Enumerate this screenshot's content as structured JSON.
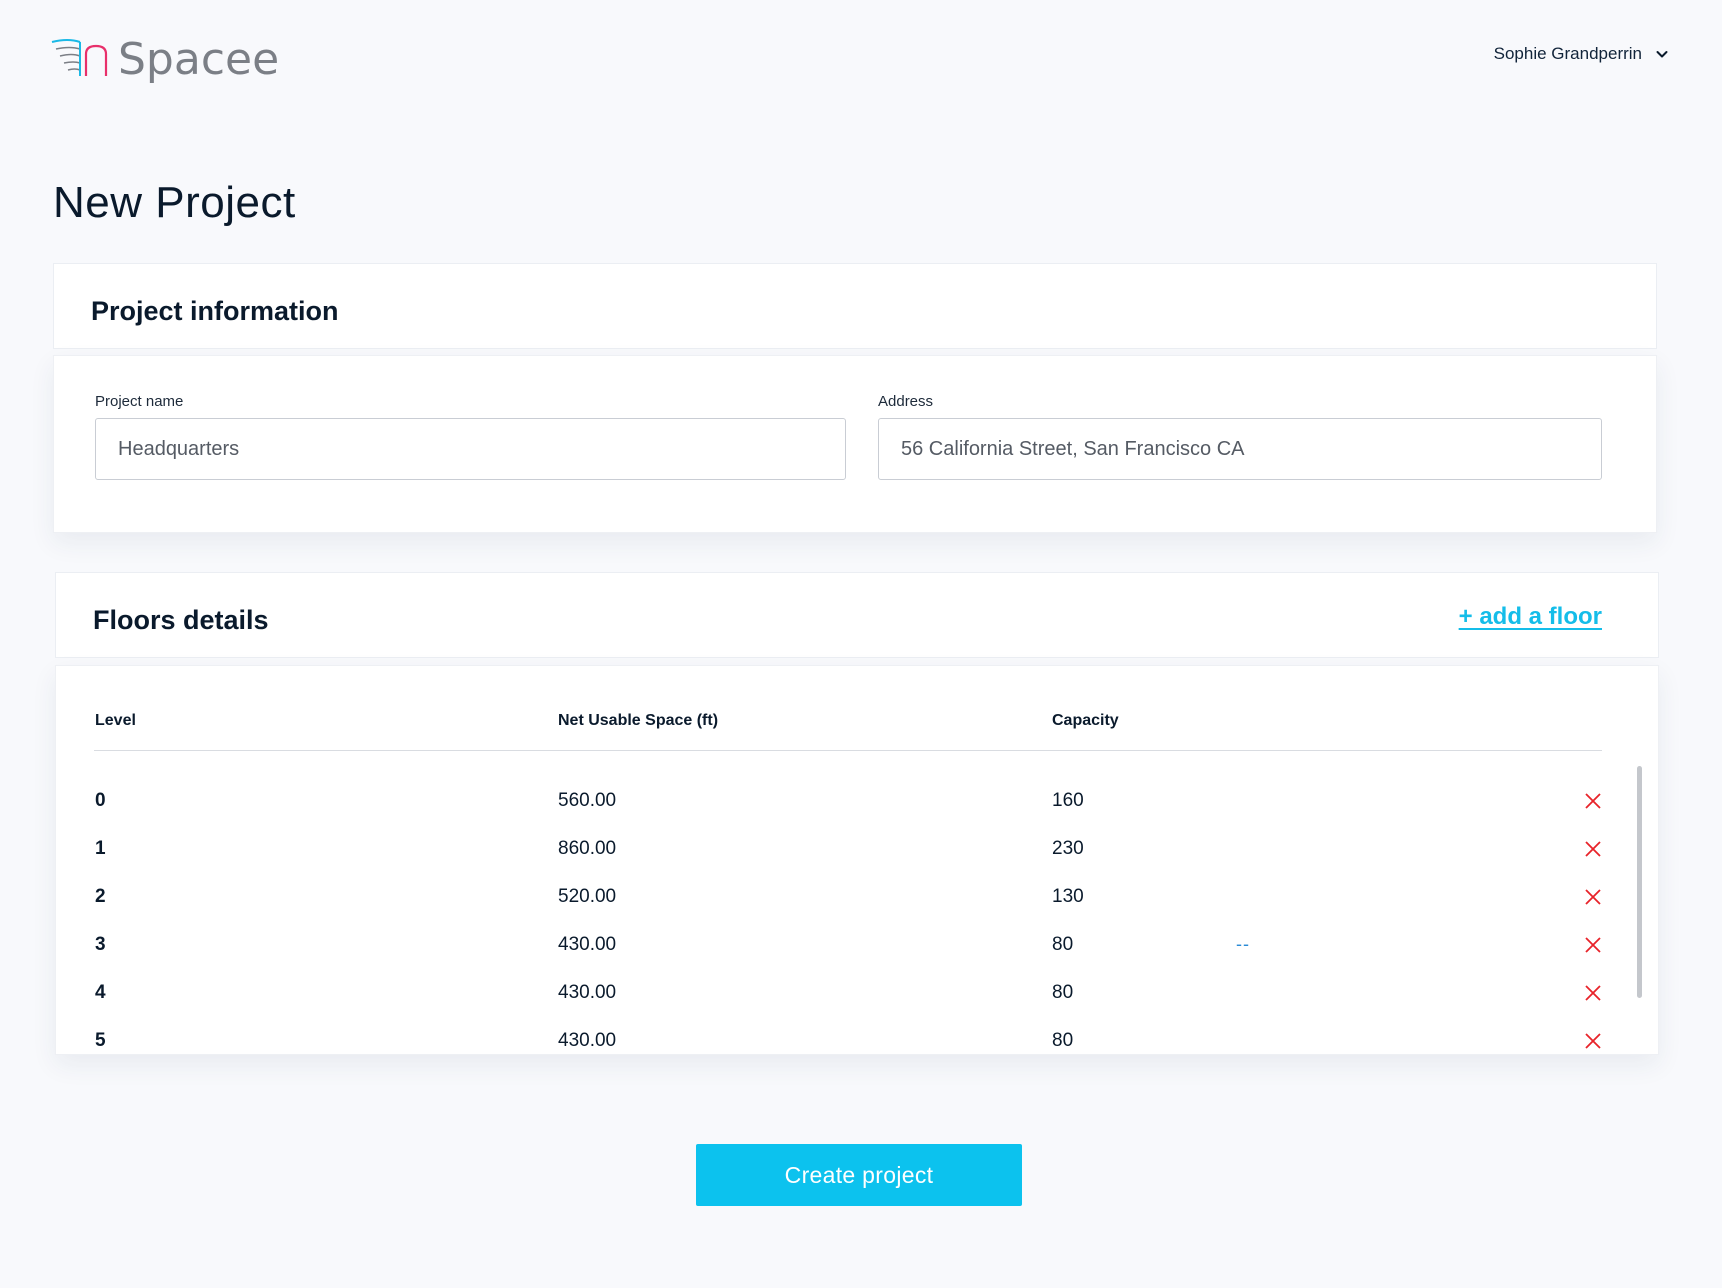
{
  "brand": {
    "name": "Spacee",
    "logo_icon": "wind-lines-logo-icon"
  },
  "user_menu": {
    "name": "Sophie Grandperrin",
    "icon": "chevron-down-icon"
  },
  "page": {
    "title": "New Project"
  },
  "project_info": {
    "heading": "Project information",
    "name_label": "Project name",
    "name_value": "Headquarters",
    "address_label": "Address",
    "address_value": "56 California Street, San Francisco CA"
  },
  "floors": {
    "heading": "Floors details",
    "add_link": "+ add a floor",
    "columns": [
      "Level",
      "Net Usable Space (ft)",
      "Capacity"
    ],
    "rows": [
      {
        "level": "0",
        "space": "560.00",
        "capacity": "160"
      },
      {
        "level": "1",
        "space": "860.00",
        "capacity": "230"
      },
      {
        "level": "2",
        "space": "520.00",
        "capacity": "130"
      },
      {
        "level": "3",
        "space": "430.00",
        "capacity": "80"
      },
      {
        "level": "4",
        "space": "430.00",
        "capacity": "80"
      },
      {
        "level": "5",
        "space": "430.00",
        "capacity": "80"
      }
    ],
    "stray_mark": "--",
    "delete_icon": "close-x-icon"
  },
  "actions": {
    "create_label": "Create project"
  },
  "colors": {
    "accent": "#0cc2ee",
    "link": "#14bde9",
    "delete": "#e8232a",
    "background": "#f8f9fc"
  }
}
